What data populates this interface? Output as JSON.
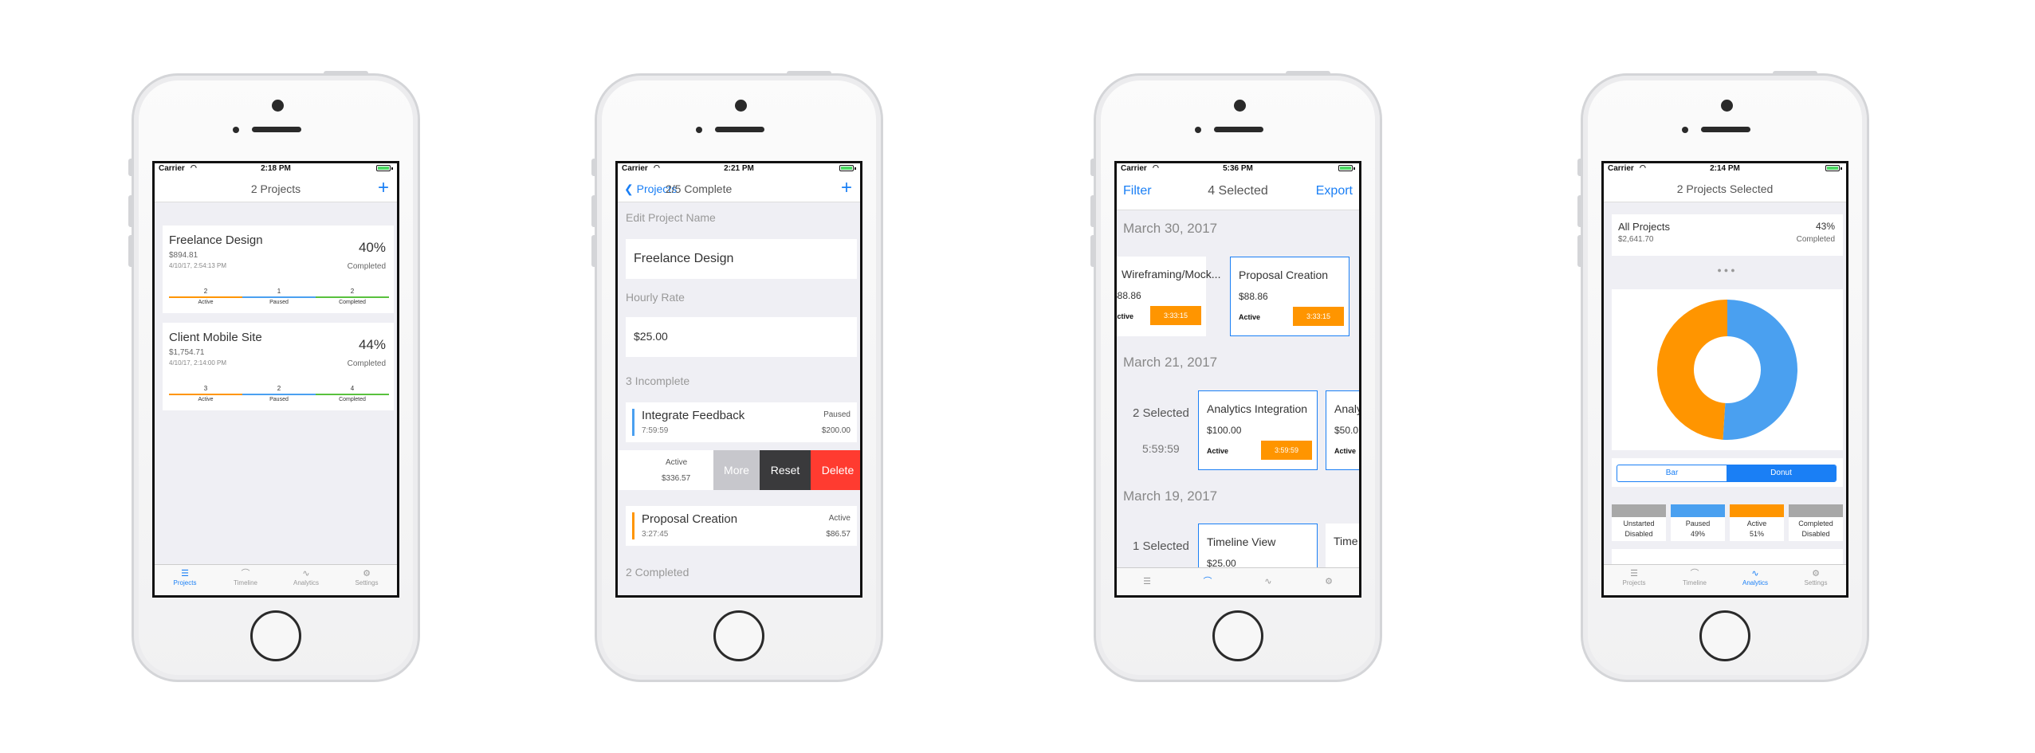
{
  "colors": {
    "accent": "#1a7ff5",
    "active": "#ff9500",
    "paused": "#4aa0f0",
    "completed": "#59c13e",
    "delete": "#ff3b30",
    "unstarted": "#a8a8a8"
  },
  "status1": {
    "carrier": "Carrier",
    "time": "2:18 PM"
  },
  "status2": {
    "carrier": "Carrier",
    "time": "2:21 PM"
  },
  "status3": {
    "carrier": "Carrier",
    "time": "5:36 PM"
  },
  "status4": {
    "carrier": "Carrier",
    "time": "2:14 PM"
  },
  "tabs": [
    "Projects",
    "Timeline",
    "Analytics",
    "Settings"
  ],
  "screen1": {
    "title": "2 Projects",
    "plus": "+",
    "projects": [
      {
        "name": "Freelance Design",
        "amount": "$894.81",
        "date": "4/10/17, 2:54:13 PM",
        "pct": "40%",
        "completed": "Completed",
        "active_count": "2",
        "paused_count": "1",
        "completed_count": "2",
        "active_label": "Active",
        "paused_label": "Paused",
        "completed_label": "Completed"
      },
      {
        "name": "Client Mobile Site",
        "amount": "$1,754.71",
        "date": "4/10/17, 2:14:00 PM",
        "pct": "44%",
        "completed": "Completed",
        "active_count": "3",
        "paused_count": "2",
        "completed_count": "4",
        "active_label": "Active",
        "paused_label": "Paused",
        "completed_label": "Completed"
      }
    ]
  },
  "screen2": {
    "back": "Projects",
    "title": "2/5 Complete",
    "plus": "+",
    "edit_label": "Edit Project Name",
    "project_name": "Freelance Design",
    "rate_label": "Hourly Rate",
    "rate": "$25.00",
    "incomplete_label": "3 Incomplete",
    "task1": {
      "name": "Integrate Feedback",
      "time": "7:59:59",
      "status": "Paused",
      "price": "$200.00"
    },
    "task2": {
      "status": "Active",
      "price": "$336.57"
    },
    "swipe": {
      "more": "More",
      "reset": "Reset",
      "delete": "Delete"
    },
    "task3": {
      "name": "Proposal Creation",
      "time": "3:27:45",
      "status": "Active",
      "price": "$86.57"
    },
    "completed_label": "2 Completed"
  },
  "screen3": {
    "filter": "Filter",
    "title": "4 Selected",
    "export": "Export",
    "sections": [
      {
        "date": "March 30, 2017"
      },
      {
        "date": "March 21, 2017",
        "selected": "2 Selected",
        "total": "5:59:59"
      },
      {
        "date": "March 19, 2017",
        "selected": "1 Selected"
      }
    ],
    "cards": {
      "c1": {
        "name": "Wireframing/Mock...",
        "price": "$88.86",
        "status": "Active",
        "time": "3:33:15"
      },
      "c2": {
        "name": "Proposal Creation",
        "price": "$88.86",
        "status": "Active",
        "time": "3:33:15"
      },
      "c3": {
        "name": "Analytics Integration",
        "price": "$100.00",
        "status": "Active",
        "time": "3:59:59"
      },
      "c4": {
        "name": "Analy",
        "price": "$50.0",
        "status": "Active"
      },
      "c5": {
        "name": "Timeline View",
        "price": "$25.00"
      },
      "c6": {
        "name": "Time"
      }
    }
  },
  "screen4": {
    "title": "2 Projects Selected",
    "summary": {
      "name": "All Projects",
      "amount": "$2,641.70",
      "pct": "43%",
      "completed": "Completed"
    },
    "donut": {
      "paused_pct": 51,
      "active_pct": 49
    },
    "toggle": {
      "bar": "Bar",
      "donut": "Donut"
    },
    "legend": [
      {
        "name": "Unstarted",
        "value": "Disabled",
        "color": "#a8a8a8"
      },
      {
        "name": "Paused",
        "value": "49%",
        "color": "#4aa0f0"
      },
      {
        "name": "Active",
        "value": "51%",
        "color": "#ff9500"
      },
      {
        "name": "Completed",
        "value": "Disabled",
        "color": "#a8a8a8"
      }
    ]
  }
}
